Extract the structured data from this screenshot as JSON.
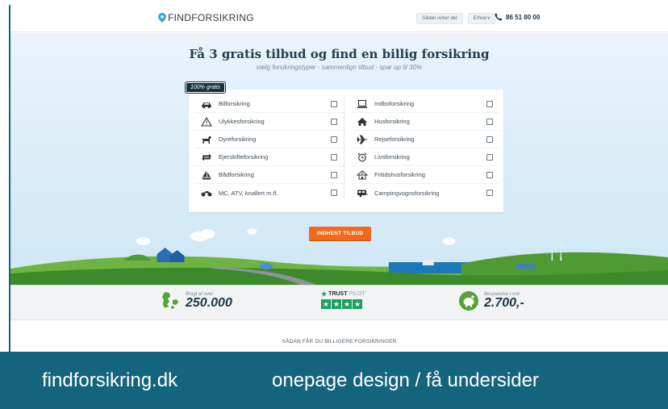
{
  "nav": {
    "logo": "FINDFORSIKRING",
    "links": [
      "Sådan virker det",
      "Erhverv"
    ],
    "phone": "86 51 80 00"
  },
  "hero": {
    "title": "Få 3 gratis tilbud og find en billig forsikring",
    "subtitle": "vælg forsikringstyper - sammenlign tilbud - spar op til 30%",
    "badge": "100% gratis",
    "cta": "INDHENT TILBUD"
  },
  "insurance_left": [
    {
      "label": "Bilforsikring",
      "icon": "car-icon"
    },
    {
      "label": "Ulykkesforsikring",
      "icon": "warning-icon"
    },
    {
      "label": "Dyreforsikring",
      "icon": "dog-icon"
    },
    {
      "label": "Ejerskifteforsikring",
      "icon": "swap-arrows-icon"
    },
    {
      "label": "Bådforsikring",
      "icon": "sailboat-icon"
    },
    {
      "label": "MC, ATV, knallert m.fl.",
      "icon": "motorcycle-icon"
    }
  ],
  "insurance_right": [
    {
      "label": "Indboforsikring",
      "icon": "laptop-icon"
    },
    {
      "label": "Husforsikring",
      "icon": "house-icon"
    },
    {
      "label": "Rejseforsikring",
      "icon": "airplane-icon"
    },
    {
      "label": "Livsforsikring",
      "icon": "alarm-clock-icon"
    },
    {
      "label": "Fritidshusforsikring",
      "icon": "cabin-icon"
    },
    {
      "label": "Campingvognsforsikring",
      "icon": "caravan-icon"
    }
  ],
  "stats": {
    "used_small": "Brugt af over",
    "used_big": "250.000",
    "trustpilot_a": "TRUST",
    "trustpilot_b": "PILOT",
    "savings_small": "Besparelse i snit",
    "savings_big": "2.700,-"
  },
  "how_title": "SÅDAN FÅR DU BILLIGERE FORSIKRINGER",
  "caption": {
    "left": "findforsikring.dk",
    "right": "onepage design / få undersider"
  },
  "colors": {
    "cta": "#ef6a1c",
    "dark": "#16323f",
    "caption_bg": "#14647d",
    "trustpilot": "#19a15f"
  }
}
